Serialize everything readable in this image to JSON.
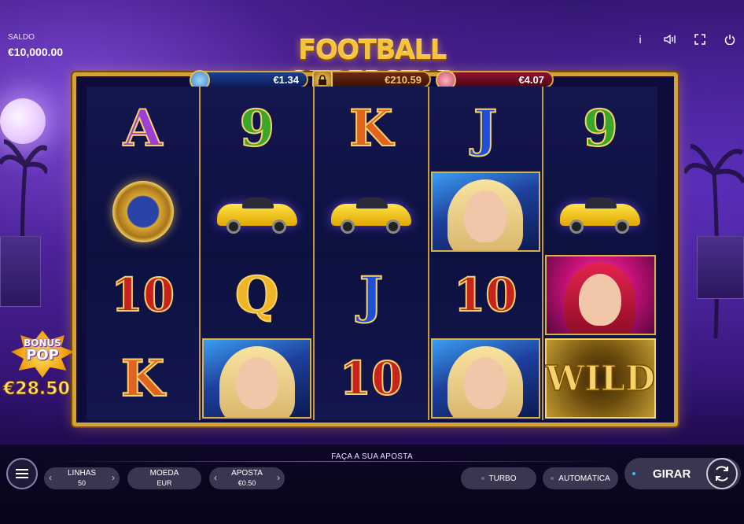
{
  "balance": {
    "label": "SALDO",
    "value": "€10,000.00"
  },
  "top_icons": [
    "info-icon",
    "sound-icon",
    "fullscreen-icon",
    "power-icon"
  ],
  "logo": "FOOTBALL SUPERSTAR",
  "jackpots": {
    "blue": "€1.34",
    "gold": "€210.59",
    "red": "€4.07"
  },
  "reels": [
    [
      "A",
      "watch",
      "10",
      "K"
    ],
    [
      "9",
      "car",
      "Q",
      "blonde"
    ],
    [
      "K",
      "car",
      "J",
      "10"
    ],
    [
      "J",
      "blonde",
      "10",
      "blonde"
    ],
    [
      "9",
      "car",
      "redhead",
      "WILD"
    ]
  ],
  "bonus_pop": {
    "line1": "BONUS",
    "line2": "POP",
    "amount": "€28.50"
  },
  "bottom": {
    "prompt": "FAÇA A SUA APOSTA",
    "linhas": {
      "label": "LINHAS",
      "value": "50"
    },
    "moeda": {
      "label": "MOEDA",
      "value": "EUR"
    },
    "aposta": {
      "label": "APOSTA",
      "value": "€0.50"
    },
    "turbo": "TURBO",
    "automatica": "AUTOMÁTICA",
    "girar": "GIRAR"
  },
  "colors": {
    "gold_frame": "#d3a338",
    "background": "#2a1060"
  }
}
